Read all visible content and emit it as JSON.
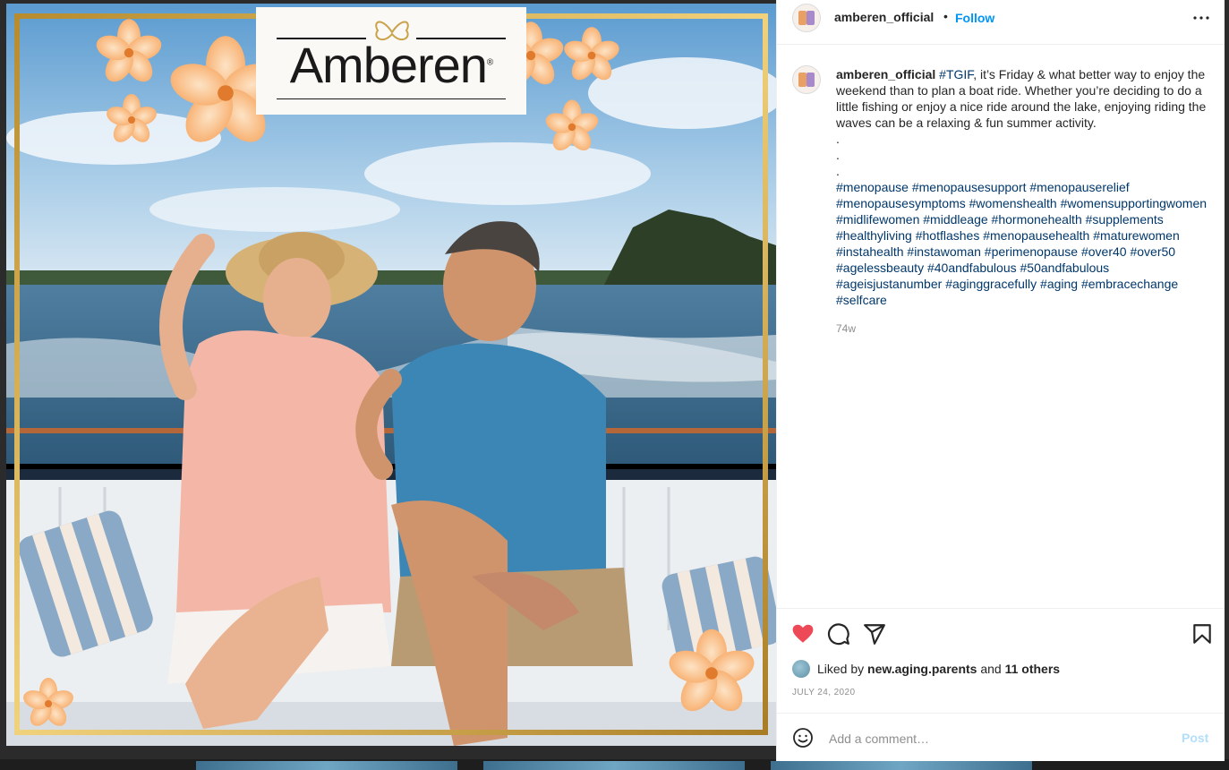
{
  "post": {
    "brand_logo_text": "Amberen",
    "brand_logo_mark": "®"
  },
  "header": {
    "username": "amberen_official",
    "separator": "•",
    "follow_label": "Follow",
    "more_icon": "more-horizontal-icon"
  },
  "caption": {
    "username": "amberen_official",
    "first_tag": "#TGIF",
    "text": ", it’s Friday & what better way to enjoy the weekend than to plan a boat ride. Whether you’re deciding to do a little fishing or enjoy a nice ride around the lake, enjoying riding the waves can be a relaxing & fun summer activity.",
    "dots": [
      ".",
      ".",
      "."
    ],
    "hashtags": [
      "#menopause",
      "#menopausesupport",
      "#menopauserelief",
      "#menopausesymptoms",
      "#womenshealth",
      "#womensupportingwomen",
      "#midlifewomen",
      "#middleage",
      "#hormonehealth",
      "#supplements",
      "#healthyliving",
      "#hotflashes",
      "#menopausehealth",
      "#maturewomen",
      "#instahealth",
      "#instawoman",
      "#perimenopause",
      "#over40",
      "#over50",
      "#agelessbeauty",
      "#40andfabulous",
      "#50andfabulous",
      "#ageisjustanumber",
      "#aginggracefully",
      "#aging",
      "#embracechange",
      "#selfcare"
    ],
    "age": "74w"
  },
  "actions": {
    "like_icon": "heart-filled-icon",
    "comment_icon": "comment-icon",
    "share_icon": "share-icon",
    "save_icon": "bookmark-icon",
    "like_color": "#ed4956"
  },
  "likes": {
    "prefix": "Liked by",
    "liker": "new.aging.parents",
    "conjunction": "and",
    "others": "11 others"
  },
  "date": "JULY 24, 2020",
  "comment": {
    "placeholder": "Add a comment…",
    "post_label": "Post",
    "emoji_icon": "emoji-icon"
  },
  "colors": {
    "link_blue": "#0095f6",
    "hashtag": "#00376b",
    "frame_gold": "#c9a24a"
  }
}
